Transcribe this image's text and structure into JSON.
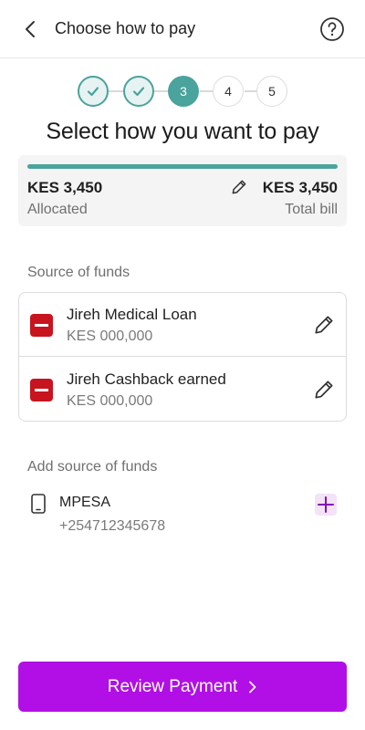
{
  "header": {
    "title": "Choose how to pay"
  },
  "stepper": {
    "steps": [
      {
        "label": "",
        "state": "done"
      },
      {
        "label": "",
        "state": "done"
      },
      {
        "label": "3",
        "state": "current"
      },
      {
        "label": "4",
        "state": "todo"
      },
      {
        "label": "5",
        "state": "todo"
      }
    ]
  },
  "page": {
    "heading": "Select how you want to pay"
  },
  "summary": {
    "allocated_amount": "KES 3,450",
    "allocated_label": "Allocated",
    "total_amount": "KES 3,450",
    "total_label": "Total bill",
    "progress": 1.0
  },
  "sources": {
    "label": "Source of funds",
    "items": [
      {
        "name": "Jireh Medical Loan",
        "amount": "KES 000,000"
      },
      {
        "name": "Jireh Cashback earned",
        "amount": "KES 000,000"
      }
    ]
  },
  "add_source": {
    "label": "Add source of funds",
    "method": {
      "name": "MPESA",
      "phone": "+254712345678"
    }
  },
  "cta": {
    "label": "Review Payment"
  },
  "colors": {
    "accent": "#4aa39c",
    "primary": "#b10fe5",
    "danger": "#c8141e"
  }
}
